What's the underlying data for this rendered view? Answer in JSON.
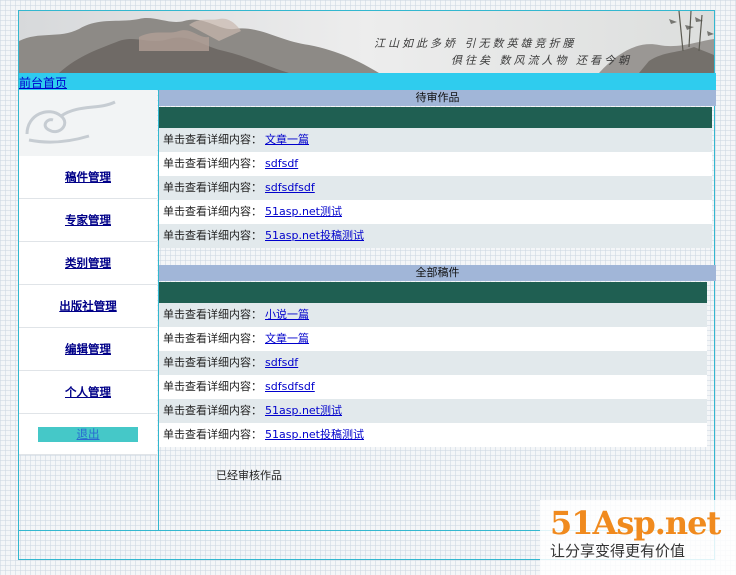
{
  "banner": {
    "poem_line1": "江山如此多娇 引无数英雄竞折腰",
    "poem_line2": "俱往矣 数风流人物 还看今朝"
  },
  "nav": {
    "home_link": "前台首页"
  },
  "sidebar": {
    "items": [
      {
        "label": "稿件管理"
      },
      {
        "label": "专家管理"
      },
      {
        "label": "类别管理"
      },
      {
        "label": "出版社管理"
      },
      {
        "label": "编辑管理"
      },
      {
        "label": "个人管理"
      }
    ],
    "quit_label": "退出"
  },
  "pending": {
    "title": "待审作品",
    "row_prefix": "单击查看详细内容：",
    "rows": [
      "文章一篇",
      "sdfsdf",
      "sdfsdfsdf",
      "51asp.net测试",
      "51asp.net投稿测试"
    ]
  },
  "all": {
    "title": "全部稿件",
    "row_prefix": "单击查看详细内容：",
    "rows": [
      "小说一篇",
      "文章一篇",
      "sdfsdf",
      "sdfsdfsdf",
      "51asp.net测试",
      "51asp.net投稿测试"
    ]
  },
  "approved_label": "已经审核作品",
  "watermark": {
    "logo": "51Asp.net",
    "slogan": "让分享变得更有价值"
  }
}
